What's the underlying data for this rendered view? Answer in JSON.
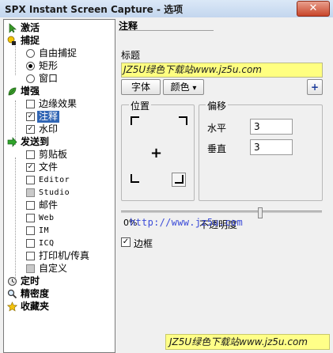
{
  "window": {
    "title": "SPX Instant Screen Capture - 选项",
    "close_glyph": "✕"
  },
  "tree": {
    "activate": "激活",
    "capture": "捕捉",
    "capture_free": "自由捕捉",
    "capture_rect": "矩形",
    "capture_window": "窗口",
    "enhance": "增强",
    "edge_effect": "边缘效果",
    "annotation": "注释",
    "watermark": "水印",
    "sendto": "发送到",
    "clipboard": "剪贴板",
    "file": "文件",
    "editor": "Editor",
    "studio": "Studio",
    "mail": "邮件",
    "web": "Web",
    "im": "IM",
    "icq": "ICQ",
    "printer_fax": "打印机/传真",
    "custom": "自定义",
    "timer": "定时",
    "precision": "精密度",
    "favorites": "收藏夹"
  },
  "panel": {
    "title": "注释",
    "title_label": "标题",
    "title_value": "JZ5U绿色下载站www.jz5u.com",
    "font_button": "字体",
    "color_button": "颜色",
    "color_arrow": "▾",
    "add_glyph": "+",
    "position_group": "位置",
    "position_center": "+",
    "offset_group": "偏移",
    "horizontal_label": "水平",
    "horizontal_value": "3",
    "vertical_label": "垂直",
    "vertical_value": "3",
    "slider_left": "0%",
    "opacity_label": "不透明度",
    "url_overlay": "http://www.jz5u.com",
    "border_label": "边框",
    "border_checked": "✓",
    "opacity_value": 0.69
  },
  "footer": {
    "watermark": "JZ5U绿色下载站www.jz5u.com"
  },
  "colors": {
    "title_field_bg": "#ffff80",
    "selection": "#3166b5",
    "close": "#c7452a"
  }
}
